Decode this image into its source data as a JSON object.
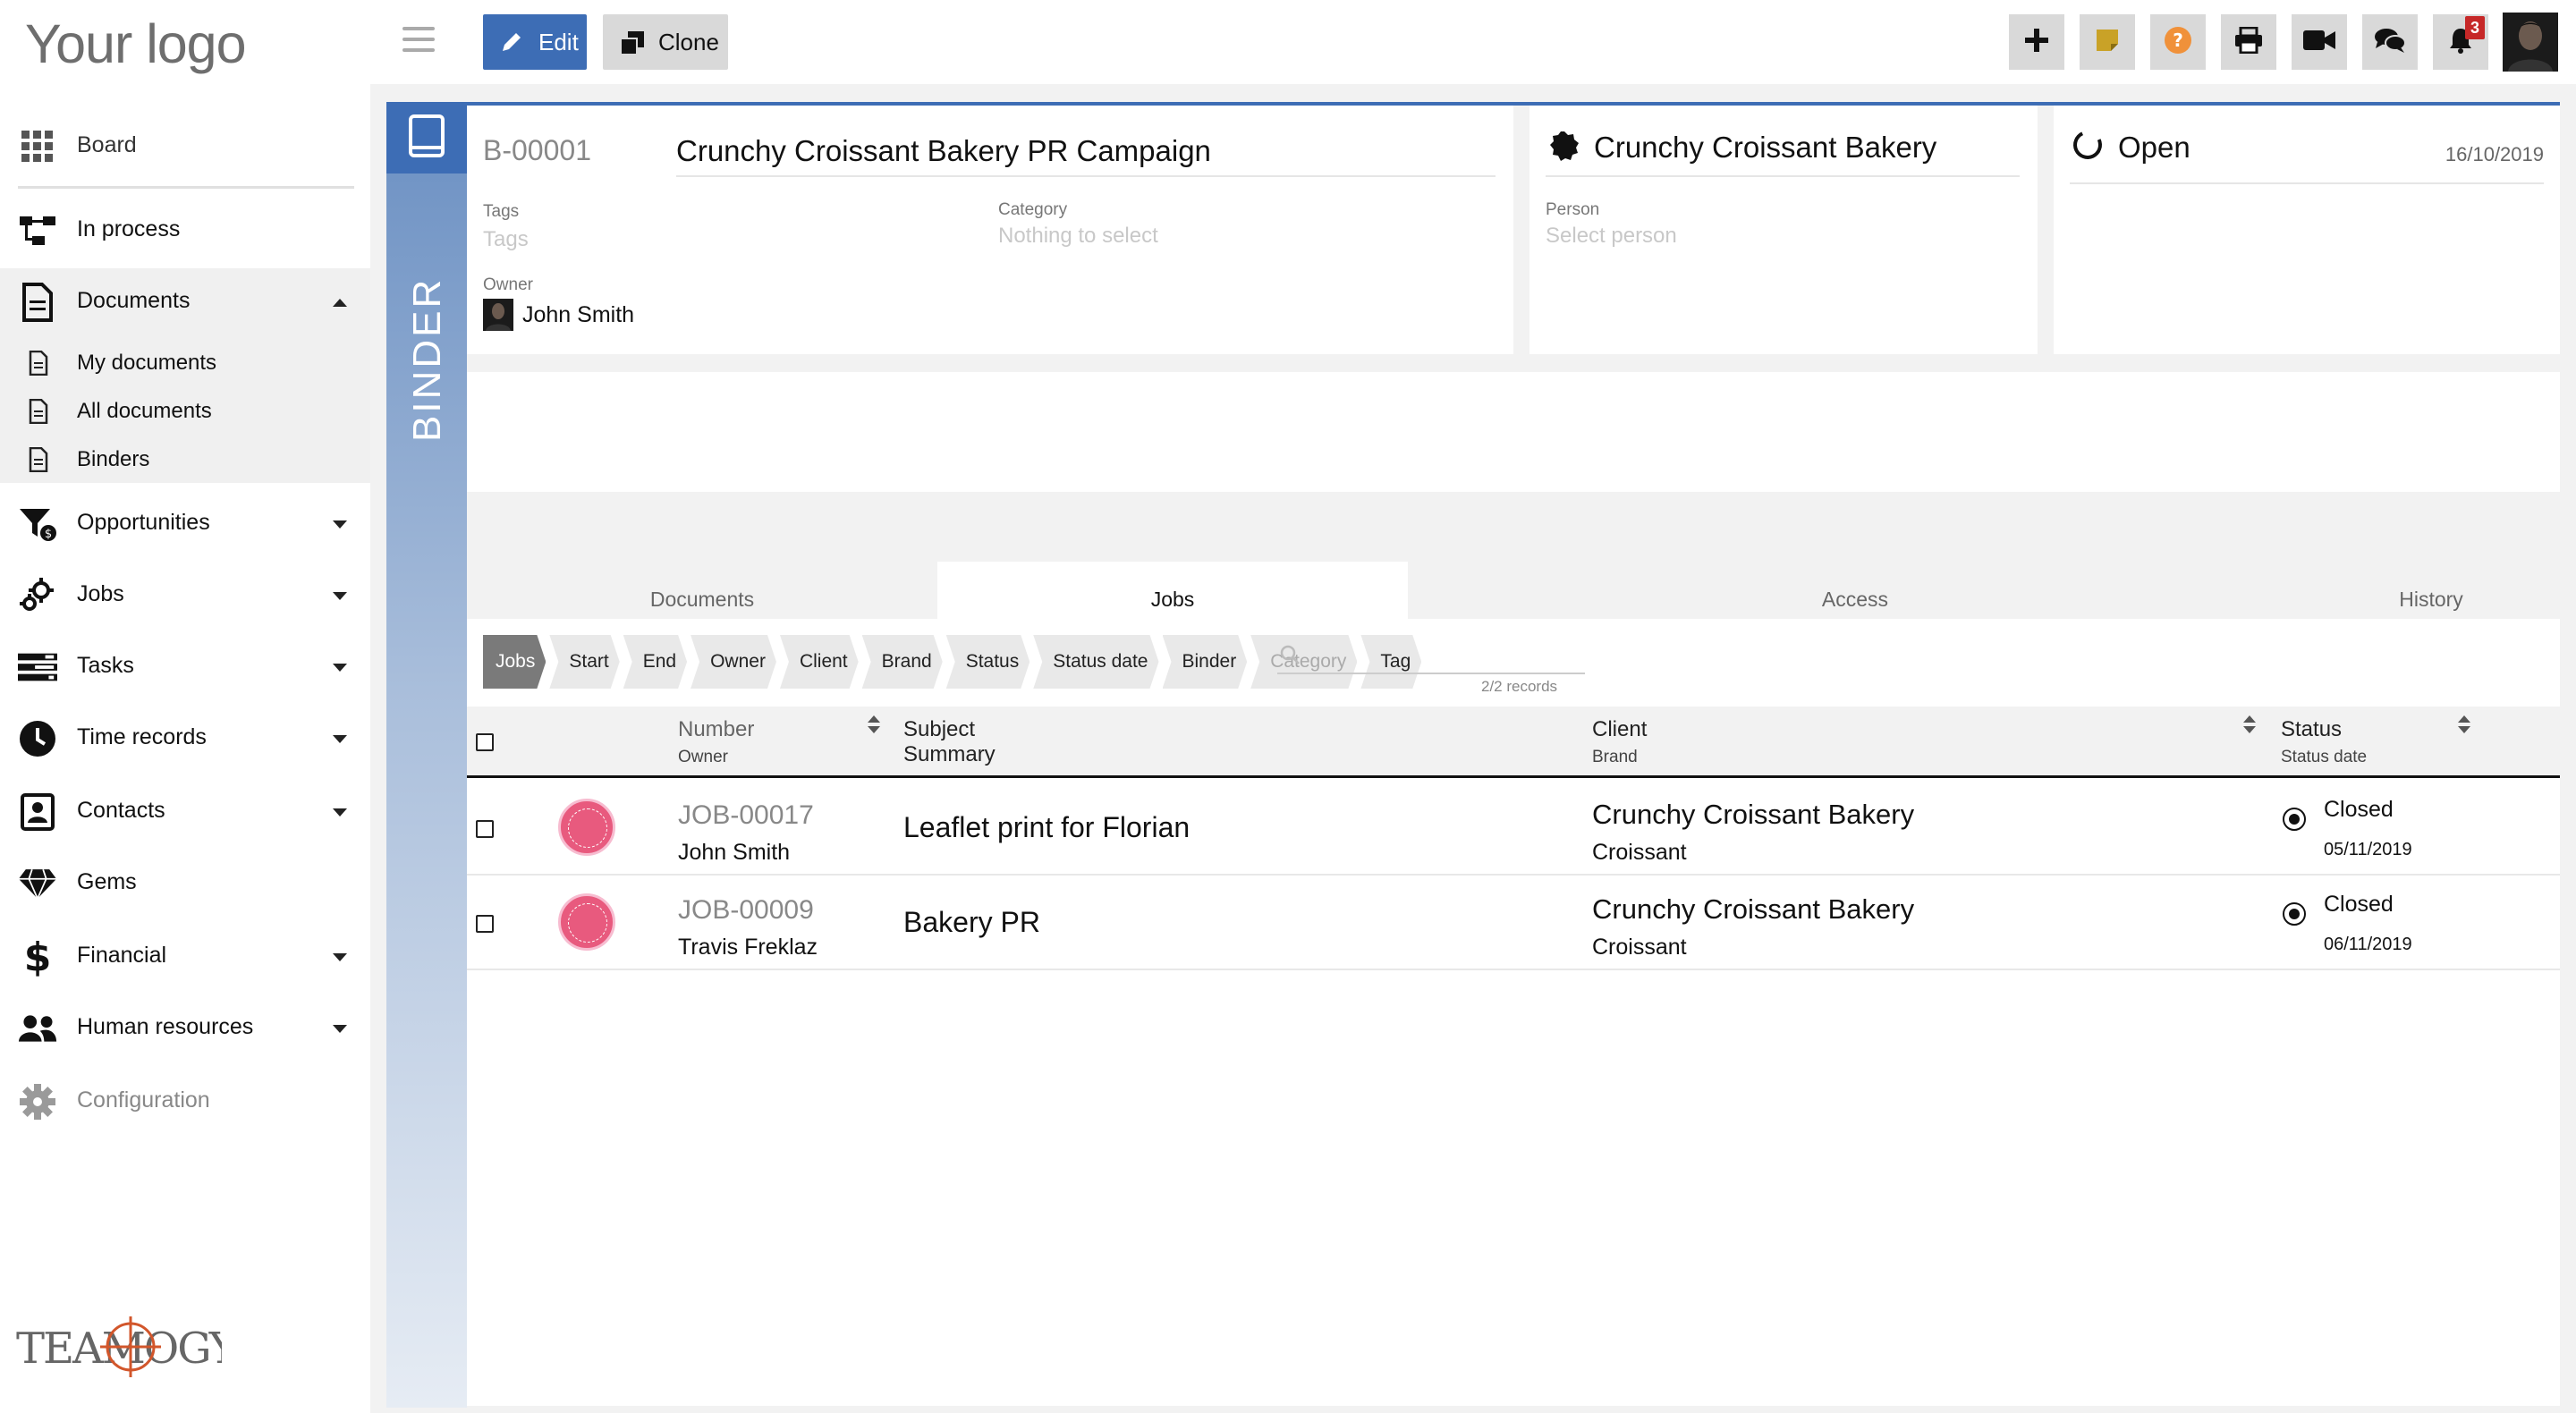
{
  "logo": "Your logo",
  "brand_footer": "TEAMOGY",
  "sidebar": {
    "items": [
      {
        "label": "Board",
        "icon": "grid-icon"
      },
      {
        "label": "In process",
        "icon": "process-icon"
      },
      {
        "label": "Documents",
        "icon": "document-icon",
        "expanded": true
      },
      {
        "label": "My documents",
        "icon": "document-icon"
      },
      {
        "label": "All documents",
        "icon": "document-icon"
      },
      {
        "label": "Binders",
        "icon": "document-icon"
      },
      {
        "label": "Opportunities",
        "icon": "funnel-icon"
      },
      {
        "label": "Jobs",
        "icon": "gears-icon"
      },
      {
        "label": "Tasks",
        "icon": "tasks-icon"
      },
      {
        "label": "Time records",
        "icon": "clock-icon"
      },
      {
        "label": "Contacts",
        "icon": "contact-card-icon"
      },
      {
        "label": "Gems",
        "icon": "gem-icon"
      },
      {
        "label": "Financial",
        "icon": "dollar-icon"
      },
      {
        "label": "Human resources",
        "icon": "people-icon"
      },
      {
        "label": "Configuration",
        "icon": "gear-icon"
      }
    ]
  },
  "toolbar": {
    "edit_label": "Edit",
    "clone_label": "Clone",
    "notifications_count": "3",
    "right_icons": [
      "plus-icon",
      "sticky-note-icon",
      "help-icon",
      "print-icon",
      "video-icon",
      "chat-icon",
      "bell-icon"
    ]
  },
  "binder": {
    "strip_label": "BINDER",
    "number": "B-00001",
    "title": "Crunchy Croissant Bakery PR Campaign",
    "tags_label": "Tags",
    "tags_placeholder": "Tags",
    "category_label": "Category",
    "category_placeholder": "Nothing to select",
    "owner_label": "Owner",
    "owner_name": "John Smith",
    "client": "Crunchy Croissant Bakery",
    "person_label": "Person",
    "person_placeholder": "Select person",
    "status": "Open",
    "date": "16/10/2019"
  },
  "tabs": [
    {
      "label": "Documents",
      "active": false
    },
    {
      "label": "Jobs",
      "active": true
    },
    {
      "label": "Access",
      "active": false
    },
    {
      "label": "History",
      "active": false
    }
  ],
  "filters": {
    "chips": [
      "Jobs",
      "Start",
      "End",
      "Owner",
      "Client",
      "Brand",
      "Status",
      "Status date",
      "Binder",
      "Category",
      "Tag"
    ],
    "records": "2/2 records"
  },
  "table": {
    "headers": {
      "number": "Number",
      "owner": "Owner",
      "subject": "Subject",
      "summary": "Summary",
      "client": "Client",
      "brand": "Brand",
      "status": "Status",
      "status_date": "Status date"
    },
    "rows": [
      {
        "number": "JOB-00017",
        "owner": "John Smith",
        "subject": "Leaflet print for Florian",
        "client": "Crunchy Croissant Bakery",
        "brand": "Croissant",
        "status": "Closed",
        "status_date": "05/11/2019"
      },
      {
        "number": "JOB-00009",
        "owner": "Travis Freklaz",
        "subject": "Bakery PR",
        "client": "Crunchy Croissant Bakery",
        "brand": "Croissant",
        "status": "Closed",
        "status_date": "06/11/2019"
      }
    ]
  },
  "colors": {
    "accent": "#3d6db5",
    "badge": "#c62828",
    "help": "#f0913a",
    "note": "#c9a227"
  }
}
